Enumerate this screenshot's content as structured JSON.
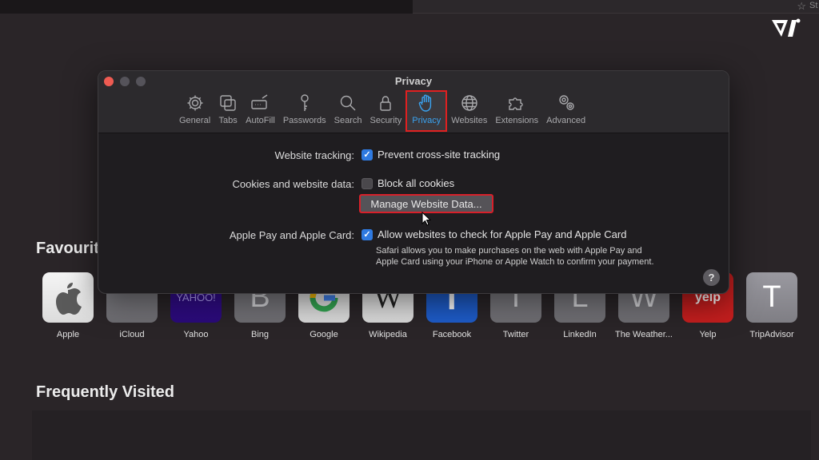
{
  "browser": {
    "top_right_text": "St",
    "star_icon": "star-icon",
    "logo": "vi-logo"
  },
  "window": {
    "title": "Privacy",
    "tabs": [
      {
        "label": "General",
        "icon": "gear-icon",
        "active": false
      },
      {
        "label": "Tabs",
        "icon": "tabs-icon",
        "active": false
      },
      {
        "label": "AutoFill",
        "icon": "autofill-icon",
        "active": false
      },
      {
        "label": "Passwords",
        "icon": "key-icon",
        "active": false
      },
      {
        "label": "Search",
        "icon": "search-icon",
        "active": false
      },
      {
        "label": "Security",
        "icon": "lock-icon",
        "active": false
      },
      {
        "label": "Privacy",
        "icon": "hand-icon",
        "active": true
      },
      {
        "label": "Websites",
        "icon": "globe-icon",
        "active": false
      },
      {
        "label": "Extensions",
        "icon": "puzzle-icon",
        "active": false
      },
      {
        "label": "Advanced",
        "icon": "gears-icon",
        "active": false
      }
    ],
    "settings": {
      "tracking_label": "Website tracking:",
      "tracking_option": "Prevent cross-site tracking",
      "tracking_checked": true,
      "cookies_label": "Cookies and website data:",
      "cookies_option": "Block all cookies",
      "cookies_checked": false,
      "manage_button": "Manage Website Data...",
      "applepay_label": "Apple Pay and Apple Card:",
      "applepay_option": "Allow websites to check for Apple Pay and Apple Card",
      "applepay_checked": true,
      "applepay_note": "Safari allows you to make purchases on the web with Apple Pay and Apple Card using your iPhone or Apple Watch to confirm your payment.",
      "help": "?"
    },
    "accent_color": "#3aa3f0",
    "highlight_color": "#e02020"
  },
  "favourites": {
    "title": "Favourites",
    "items": [
      {
        "label": "Apple",
        "glyph": ""
      },
      {
        "label": "iCloud",
        "glyph": ""
      },
      {
        "label": "Yahoo",
        "glyph": "YAHOO!"
      },
      {
        "label": "Bing",
        "glyph": "B"
      },
      {
        "label": "Google",
        "glyph": "G"
      },
      {
        "label": "Wikipedia",
        "glyph": "W"
      },
      {
        "label": "Facebook",
        "glyph": "f"
      },
      {
        "label": "Twitter",
        "glyph": "T"
      },
      {
        "label": "LinkedIn",
        "glyph": "L"
      },
      {
        "label": "The Weather...",
        "glyph": "W"
      },
      {
        "label": "Yelp",
        "glyph": "yelp"
      },
      {
        "label": "TripAdvisor",
        "glyph": "T"
      }
    ]
  },
  "frequently_visited": {
    "title": "Frequently Visited"
  }
}
